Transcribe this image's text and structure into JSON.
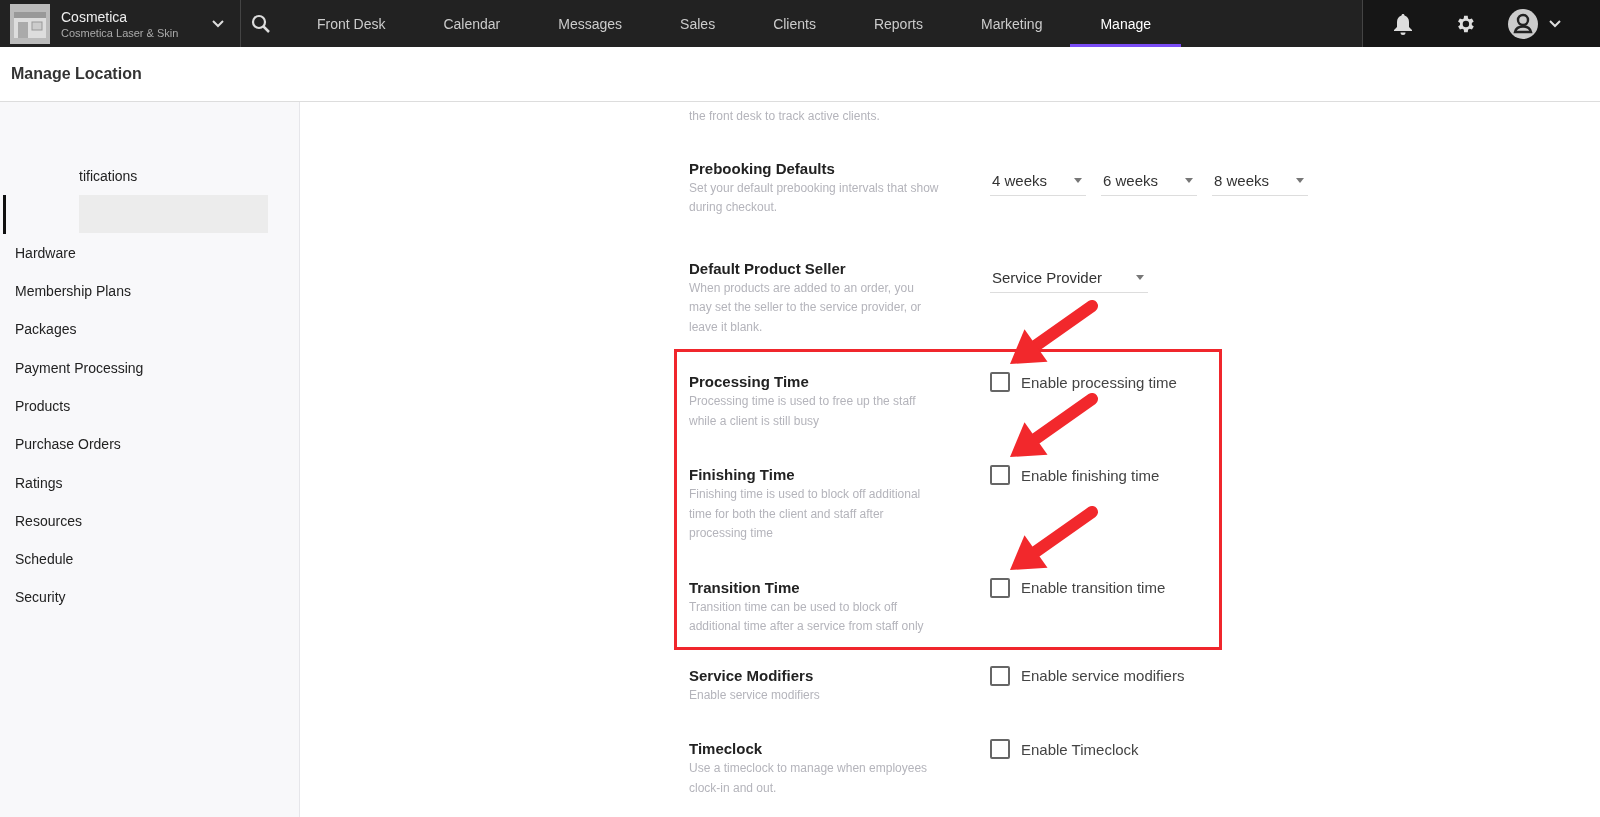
{
  "topbar": {
    "business": {
      "name": "Cosmetica",
      "location": "Cosmetica Laser & Skin"
    },
    "nav": [
      {
        "label": "Front Desk",
        "selected": false
      },
      {
        "label": "Calendar",
        "selected": false
      },
      {
        "label": "Messages",
        "selected": false
      },
      {
        "label": "Sales",
        "selected": false
      },
      {
        "label": "Clients",
        "selected": false
      },
      {
        "label": "Reports",
        "selected": false
      },
      {
        "label": "Marketing",
        "selected": false
      },
      {
        "label": "Manage",
        "selected": true
      }
    ]
  },
  "page_title": "Manage Location",
  "sidebar": {
    "items": [
      {
        "kind": "shifted",
        "label": "tifications",
        "selected": false
      },
      {
        "kind": "redacted",
        "selected": true
      },
      {
        "kind": "plain",
        "label": "Hardware",
        "selected": false
      },
      {
        "kind": "plain",
        "label": "Membership Plans",
        "selected": false
      },
      {
        "kind": "plain",
        "label": "Packages",
        "selected": false
      },
      {
        "kind": "plain",
        "label": "Payment Processing",
        "selected": false
      },
      {
        "kind": "plain",
        "label": "Products",
        "selected": false
      },
      {
        "kind": "plain",
        "label": "Purchase Orders",
        "selected": false
      },
      {
        "kind": "plain",
        "label": "Ratings",
        "selected": false
      },
      {
        "kind": "plain",
        "label": "Resources",
        "selected": false
      },
      {
        "kind": "plain",
        "label": "Schedule",
        "selected": false
      },
      {
        "kind": "plain",
        "label": "Security",
        "selected": false
      }
    ]
  },
  "settings": [
    {
      "description": "the front desk to track active clients.",
      "highlighted": false
    },
    {
      "title": "Prebooking Defaults",
      "description": "Set your default prebooking intervals that show during checkout.",
      "highlighted": false,
      "control": {
        "kind": "selects",
        "values": [
          "4 weeks",
          "6 weeks",
          "8 weeks"
        ]
      }
    },
    {
      "title": "Default Product Seller",
      "description": "When products are added to an order, you may set the seller to the service provider, or leave it blank.",
      "highlighted": false,
      "control": {
        "kind": "select",
        "value": "Service Provider"
      }
    },
    {
      "title": "Processing Time",
      "description": "Processing time is used to free up the staff while a client is still busy",
      "highlighted": true,
      "control": {
        "kind": "checkbox",
        "label": "Enable processing time",
        "checked": false
      }
    },
    {
      "title": "Finishing Time",
      "description": "Finishing time is used to block off additional time for both the client and staff after processing time",
      "highlighted": true,
      "control": {
        "kind": "checkbox",
        "label": "Enable finishing time",
        "checked": false
      }
    },
    {
      "title": "Transition Time",
      "description": "Transition time can be used to block off additional time after a service from staff only",
      "highlighted": true,
      "control": {
        "kind": "checkbox",
        "label": "Enable transition time",
        "checked": false
      }
    },
    {
      "title": "Service Modifiers",
      "description": "Enable service modifiers",
      "highlighted": false,
      "control": {
        "kind": "checkbox",
        "label": "Enable service modifiers",
        "checked": false
      }
    },
    {
      "title": "Timeclock",
      "description": "Use a timeclock to manage when employees clock-in and out.",
      "highlighted": false,
      "control": {
        "kind": "checkbox",
        "label": "Enable Timeclock",
        "checked": false
      }
    }
  ]
}
